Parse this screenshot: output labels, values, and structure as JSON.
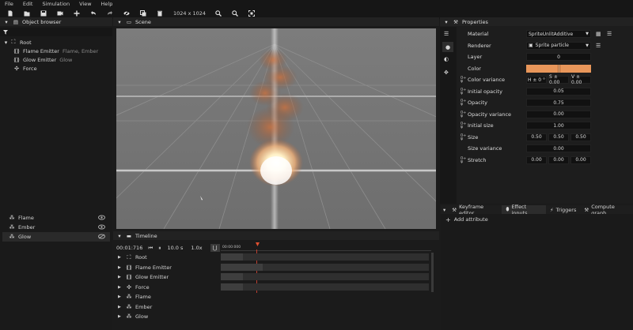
{
  "menu": [
    "File",
    "Edit",
    "Simulation",
    "View",
    "Help"
  ],
  "toolbar": {
    "resolution": "1024 x 1024"
  },
  "object_browser": {
    "title": "Object browser",
    "filter_icon": "filter-icon",
    "tree": [
      {
        "label": "Root",
        "icon": "root-icon",
        "detail": ""
      },
      {
        "label": "Flame Emitter",
        "icon": "emitter-icon",
        "detail": "Flame, Ember"
      },
      {
        "label": "Glow Emitter",
        "icon": "emitter-icon",
        "detail": "Glow"
      },
      {
        "label": "Force",
        "icon": "force-icon",
        "detail": ""
      }
    ],
    "layers": [
      "Flame",
      "Ember",
      "Glow"
    ]
  },
  "scene": {
    "title": "Scene"
  },
  "timeline": {
    "title": "Timeline",
    "time": "00:01:716",
    "duration": "10.0 s",
    "speed": "1.0x",
    "ruler_start": "00:00:000",
    "rows": [
      "Root",
      "Flame Emitter",
      "Glow Emitter",
      "Force",
      "Flame",
      "Ember",
      "Glow"
    ]
  },
  "properties": {
    "title": "Properties",
    "material": {
      "label": "Material",
      "value": "SpriteUnlitAdditive"
    },
    "renderer": {
      "label": "Renderer",
      "value": "Sprite particle"
    },
    "layer": {
      "label": "Layer",
      "value": "0"
    },
    "color": {
      "label": "Color",
      "value": "#e8965a"
    },
    "color_variance": {
      "label": "Color variance",
      "h": "H ± 0 °",
      "s": "S ± 0.00",
      "v": "V ± 0.00"
    },
    "initial_opacity": {
      "label": "Initial opacity",
      "value": "0.05"
    },
    "opacity": {
      "label": "Opacity",
      "value": "0.75"
    },
    "opacity_variance": {
      "label": "Opacity variance",
      "value": "0.00"
    },
    "initial_size": {
      "label": "Initial size",
      "value": "1.00"
    },
    "size": {
      "label": "Size",
      "a": "0.50",
      "b": "0.50",
      "c": "0.50"
    },
    "size_variance": {
      "label": "Size variance",
      "value": "0.00"
    },
    "stretch": {
      "label": "Stretch",
      "a": "0.00",
      "b": "0.00",
      "c": "0.00"
    }
  },
  "bottom_tabs": [
    "Keyframe editor",
    "Effect inputs",
    "Triggers",
    "Compute graph"
  ],
  "effect_inputs": {
    "add_attribute": "Add attribute"
  }
}
